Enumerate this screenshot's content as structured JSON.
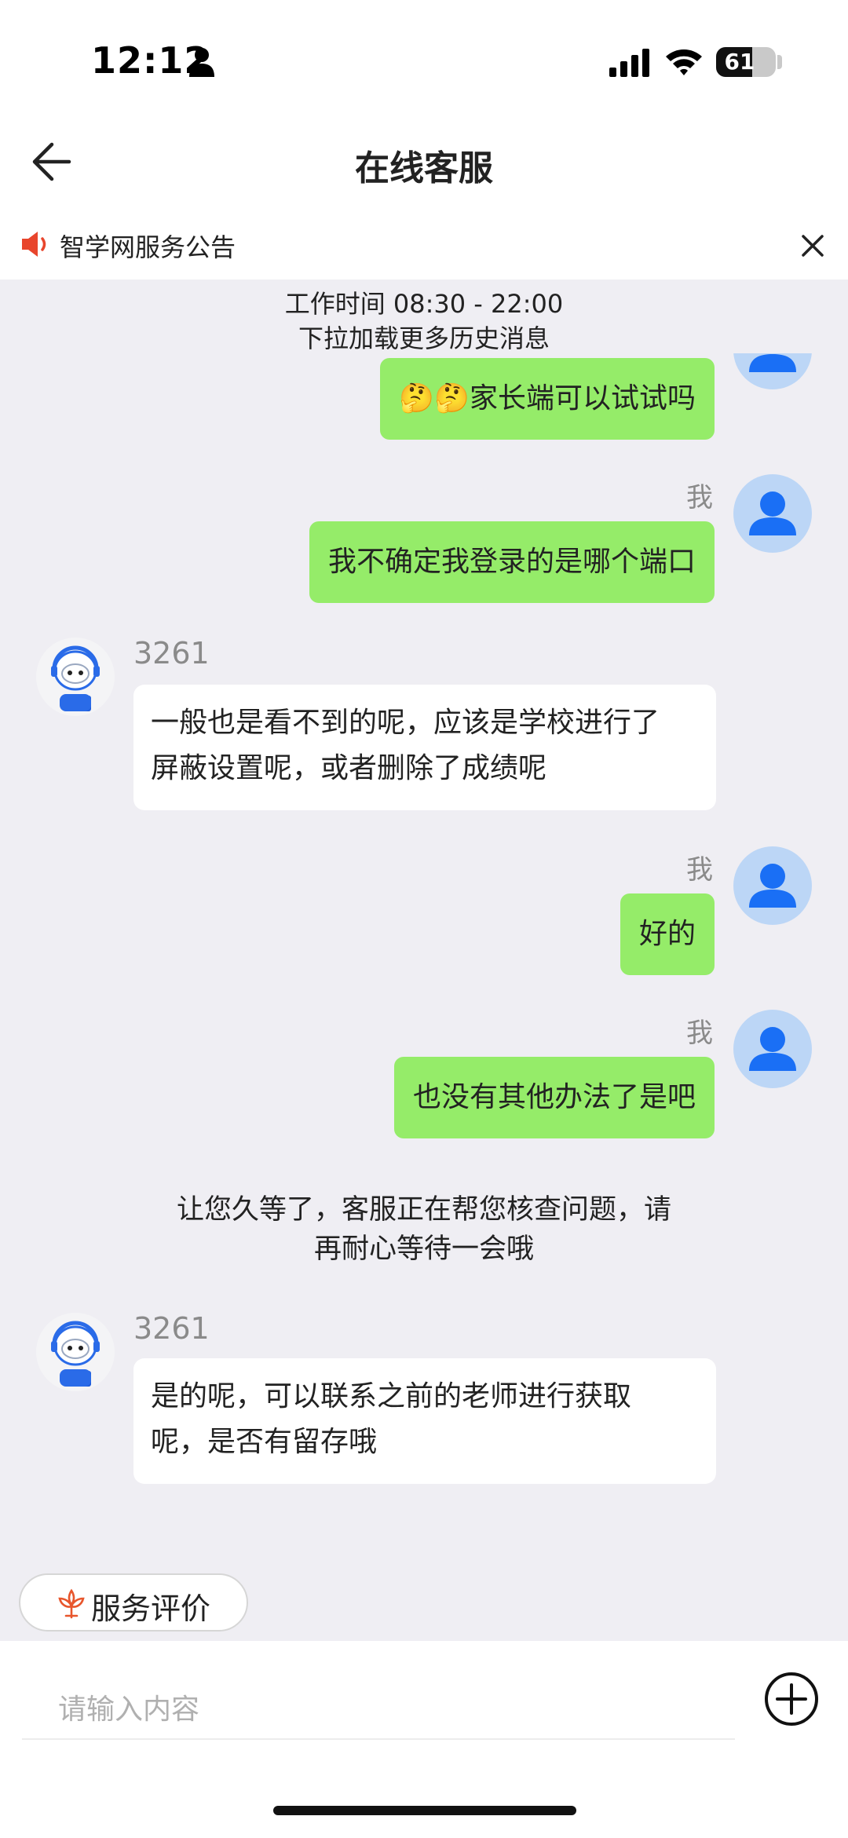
{
  "status_bar": {
    "time": "12:12",
    "battery_level": "61",
    "battery_fraction": 0.61
  },
  "nav": {
    "title": "在线客服"
  },
  "notice": {
    "text": "智学网服务公告"
  },
  "system": {
    "working_hours": "工作时间 08:30 - 22:00",
    "pull_more": "下拉加载更多历史消息",
    "wait_notice_line1": "让您久等了，客服正在帮您核查问题，请",
    "wait_notice_line2": "再耐心等待一会哦"
  },
  "messages": [
    {
      "from": "me",
      "name": "",
      "text": "🤔🤔家长端可以试试吗"
    },
    {
      "from": "me",
      "name": "我",
      "text": "我不确定我登录的是哪个端口"
    },
    {
      "from": "agent",
      "name": "3261",
      "line1": "一般也是看不到的呢，应该是学校进行了",
      "line2": "屏蔽设置呢，或者删除了成绩呢"
    },
    {
      "from": "me",
      "name": "我",
      "text": "好的"
    },
    {
      "from": "me",
      "name": "我",
      "text": "也没有其他办法了是吧"
    },
    {
      "from": "agent",
      "name": "3261",
      "line1": "是的呢，可以联系之前的老师进行获取",
      "line2": "呢，是否有留存哦"
    }
  ],
  "rating": {
    "label": "服务评价"
  },
  "composer": {
    "placeholder": "请输入内容"
  },
  "colors": {
    "my_bubble": "#95ec69",
    "agent_bubble": "#ffffff",
    "background": "#efeef3",
    "speaker": "#e8452c"
  }
}
